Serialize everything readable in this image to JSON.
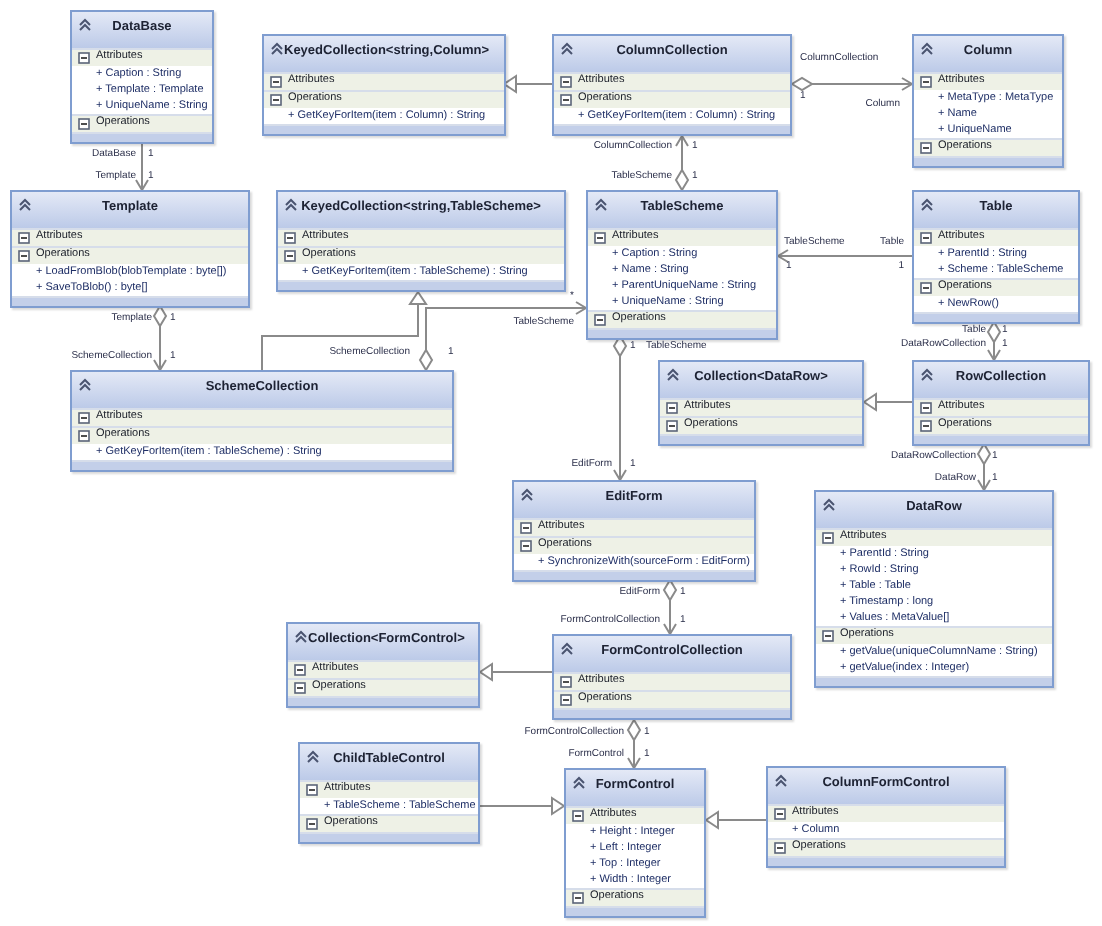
{
  "classes": [
    {
      "name": "DataBase",
      "attributes_label": "Attributes",
      "attributes": [
        "+ Caption : String",
        "+ Template : Template",
        "+ UniqueName : String"
      ],
      "operations_label": "Operations"
    },
    {
      "name": "KeyedCollection<string,Column>",
      "attributes_label": "Attributes",
      "operations_label": "Operations",
      "operations": [
        "+ GetKeyForItem(item : Column) : String"
      ]
    },
    {
      "name": "ColumnCollection",
      "attributes_label": "Attributes",
      "operations_label": "Operations",
      "operations": [
        "+ GetKeyForItem(item : Column) : String"
      ]
    },
    {
      "name": "Column",
      "attributes_label": "Attributes",
      "attributes": [
        "+ MetaType : MetaType",
        "+ Name",
        "+ UniqueName"
      ],
      "operations_label": "Operations"
    },
    {
      "name": "Template",
      "attributes_label": "Attributes",
      "operations_label": "Operations",
      "operations": [
        "+ LoadFromBlob(blobTemplate : byte[])",
        "+ SaveToBlob() : byte[]"
      ]
    },
    {
      "name": "KeyedCollection<string,TableScheme>",
      "attributes_label": "Attributes",
      "operations_label": "Operations",
      "operations": [
        "+ GetKeyForItem(item : TableScheme) : String"
      ]
    },
    {
      "name": "TableScheme",
      "attributes_label": "Attributes",
      "attributes": [
        "+ Caption : String",
        "+ Name : String",
        "+ ParentUniqueName : String",
        "+ UniqueName : String"
      ],
      "operations_label": "Operations"
    },
    {
      "name": "Table",
      "attributes_label": "Attributes",
      "attributes": [
        "+ ParentId : String",
        "+ Scheme : TableScheme"
      ],
      "operations_label": "Operations",
      "operations": [
        "+ NewRow()"
      ]
    },
    {
      "name": "SchemeCollection",
      "attributes_label": "Attributes",
      "operations_label": "Operations",
      "operations": [
        "+ GetKeyForItem(item : TableScheme) : String"
      ]
    },
    {
      "name": "Collection<DataRow>",
      "attributes_label": "Attributes",
      "operations_label": "Operations"
    },
    {
      "name": "RowCollection",
      "attributes_label": "Attributes",
      "operations_label": "Operations"
    },
    {
      "name": "EditForm",
      "attributes_label": "Attributes",
      "operations_label": "Operations",
      "operations": [
        "+ SynchronizeWith(sourceForm : EditForm)"
      ]
    },
    {
      "name": "DataRow",
      "attributes_label": "Attributes",
      "attributes": [
        "+ ParentId : String",
        "+ RowId : String",
        "+ Table : Table",
        "+ Timestamp : long",
        "+ Values : MetaValue[]"
      ],
      "operations_label": "Operations",
      "operations": [
        "+ getValue(uniqueColumnName : String)",
        "+ getValue(index : Integer)"
      ]
    },
    {
      "name": "Collection<FormControl>",
      "attributes_label": "Attributes",
      "operations_label": "Operations"
    },
    {
      "name": "FormControlCollection",
      "attributes_label": "Attributes",
      "operations_label": "Operations"
    },
    {
      "name": "ChildTableControl",
      "attributes_label": "Attributes",
      "attributes": [
        "+ TableScheme : TableScheme"
      ],
      "operations_label": "Operations"
    },
    {
      "name": "FormControl",
      "attributes_label": "Attributes",
      "attributes": [
        "+ Height : Integer",
        "+ Left : Integer",
        "+ Top : Integer",
        "+ Width : Integer"
      ],
      "operations_label": "Operations"
    },
    {
      "name": "ColumnFormControl",
      "attributes_label": "Attributes",
      "attributes": [
        "+ Column"
      ],
      "operations_label": "Operations"
    }
  ],
  "connectors": [
    {
      "kind": "association",
      "labels": [
        "DataBase",
        "1",
        "Template",
        "1"
      ]
    },
    {
      "kind": "aggregation",
      "labels": [
        "Template",
        "1",
        "SchemeCollection",
        "1"
      ]
    },
    {
      "kind": "generalization"
    },
    {
      "kind": "aggregation",
      "labels": [
        "SchemeCollection",
        "1",
        "TableScheme",
        "*"
      ]
    },
    {
      "kind": "generalization"
    },
    {
      "kind": "aggregation",
      "labels": [
        "ColumnCollection",
        "1",
        "Column"
      ]
    },
    {
      "kind": "aggregation",
      "labels": [
        "ColumnCollection",
        "1",
        "TableScheme",
        "1"
      ]
    },
    {
      "kind": "association",
      "labels": [
        "TableScheme",
        "Table",
        "1",
        "1"
      ]
    },
    {
      "kind": "aggregation",
      "labels": [
        "Table",
        "1",
        "DataRowCollection",
        "1"
      ]
    },
    {
      "kind": "generalization"
    },
    {
      "kind": "aggregation",
      "labels": [
        "DataRowCollection",
        "1",
        "DataRow",
        "1"
      ]
    },
    {
      "kind": "aggregation",
      "labels": [
        "1",
        "TableScheme",
        "EditForm",
        "1"
      ]
    },
    {
      "kind": "aggregation",
      "labels": [
        "EditForm",
        "1",
        "FormControlCollection",
        "1"
      ]
    },
    {
      "kind": "generalization"
    },
    {
      "kind": "aggregation",
      "labels": [
        "FormControlCollection",
        "1",
        "FormControl",
        "1"
      ]
    },
    {
      "kind": "generalization"
    },
    {
      "kind": "generalization"
    }
  ]
}
